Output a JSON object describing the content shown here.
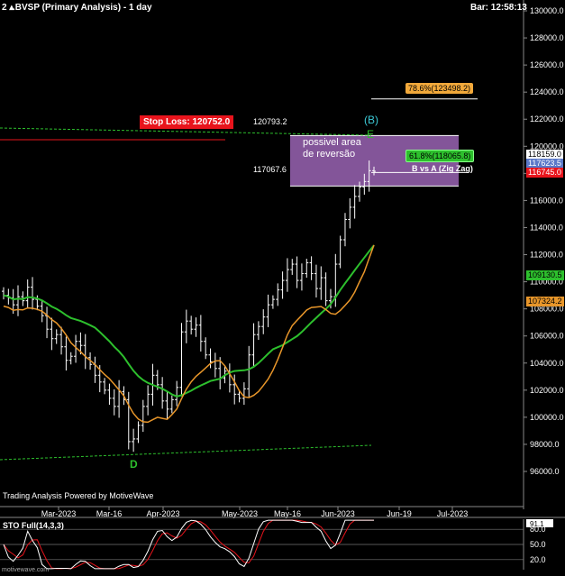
{
  "header": {
    "corner_label": "2 ▴",
    "title": ".BVSP (Primary Analysis) - 1 day",
    "bar_time": "Bar: 12:58:13"
  },
  "annotations": {
    "stop_loss": "Stop Loss: 120752.0",
    "level_top": "120793.2",
    "level_bottom": "117067.6",
    "box_text_line1": "possivel area",
    "box_text_line2": "de reversão",
    "fib_786": "78.6%(123498.2)",
    "fib_618": "61.8%(118065.8)",
    "wave_label": "B vs A (Zig Zag)",
    "point_b": "(B)",
    "point_e": "E",
    "point_d": "D"
  },
  "price_labels": {
    "last": "118159.0",
    "last_blue": "117623.5",
    "last_red": "116745.0",
    "ma_green": "109130.5",
    "ma_orange": "107324.2"
  },
  "footer": "Trading Analysis Powered by MotiveWave",
  "watermark": "motivewave.com",
  "colors": {
    "background": "#000000",
    "bars": "#ffffff",
    "ma_fast": "#2dbf2d",
    "ma_slow": "#e8962a",
    "stop_loss": "#e8141c",
    "box": "#9a64b4",
    "sto_k": "#ffffff",
    "sto_d": "#e8141c"
  },
  "chart_data": {
    "type": "ohlc",
    "y_axis": {
      "min": 95000,
      "max": 130000,
      "ticks": [
        96000,
        98000,
        100000,
        102000,
        104000,
        106000,
        108000,
        110000,
        112000,
        114000,
        116000,
        118000,
        120000,
        122000,
        124000,
        126000,
        128000,
        130000
      ],
      "tick_labels": [
        "96000.0",
        "98000.0",
        "100000.0",
        "102000.0",
        "104000.0",
        "106000.0",
        "108000.0",
        "110000.0",
        "112000.0",
        "114000.0",
        "116000.0",
        "118000.0",
        "120000.0",
        "122000.0",
        "124000.0",
        "126000.0",
        "128000.0",
        "130000.0"
      ]
    },
    "x_axis": {
      "ticks": [
        "Mar-2023",
        "Mar-16",
        "Apr-2023",
        "May-2023",
        "May-16",
        "Jun-2023",
        "Jun-19",
        "Jul-2023"
      ]
    },
    "closes": [
      109000,
      108800,
      108300,
      108900,
      108600,
      109600,
      108700,
      108200,
      107500,
      106500,
      105800,
      106100,
      105200,
      104200,
      104500,
      105600,
      105300,
      104400,
      103900,
      103100,
      102600,
      102000,
      101400,
      100800,
      101900,
      101300,
      98200,
      98400,
      99400,
      100800,
      101700,
      103100,
      102400,
      101200,
      100600,
      101300,
      102200,
      106300,
      107100,
      106500,
      106800,
      105600,
      104600,
      104100,
      103600,
      102900,
      103400,
      102400,
      101700,
      101400,
      102100,
      104600,
      106100,
      106700,
      107400,
      108300,
      108700,
      109400,
      110100,
      110900,
      111300,
      110100,
      110600,
      111400,
      110600,
      109500,
      110300,
      108600,
      108900,
      111300,
      113100,
      114600,
      115500,
      116300,
      117000,
      117400,
      118200,
      118159
    ],
    "moving_averages": [
      {
        "name": "ma_fast",
        "last": 109130.5
      },
      {
        "name": "ma_slow",
        "last": 107324.2
      }
    ],
    "levels": {
      "stop_loss": 120752.0,
      "area_top": 120793.2,
      "area_bottom": 117067.6,
      "fib_786": 123498.2,
      "fib_618": 118065.8
    },
    "stochastic": {
      "params": "STO Full(14,3,3)",
      "ticks": [
        20.0,
        50.0,
        80.0
      ],
      "tick_labels": [
        "20.0",
        "50.0",
        "80.0"
      ],
      "last_k": 91.1,
      "last_d": 87.5
    }
  }
}
